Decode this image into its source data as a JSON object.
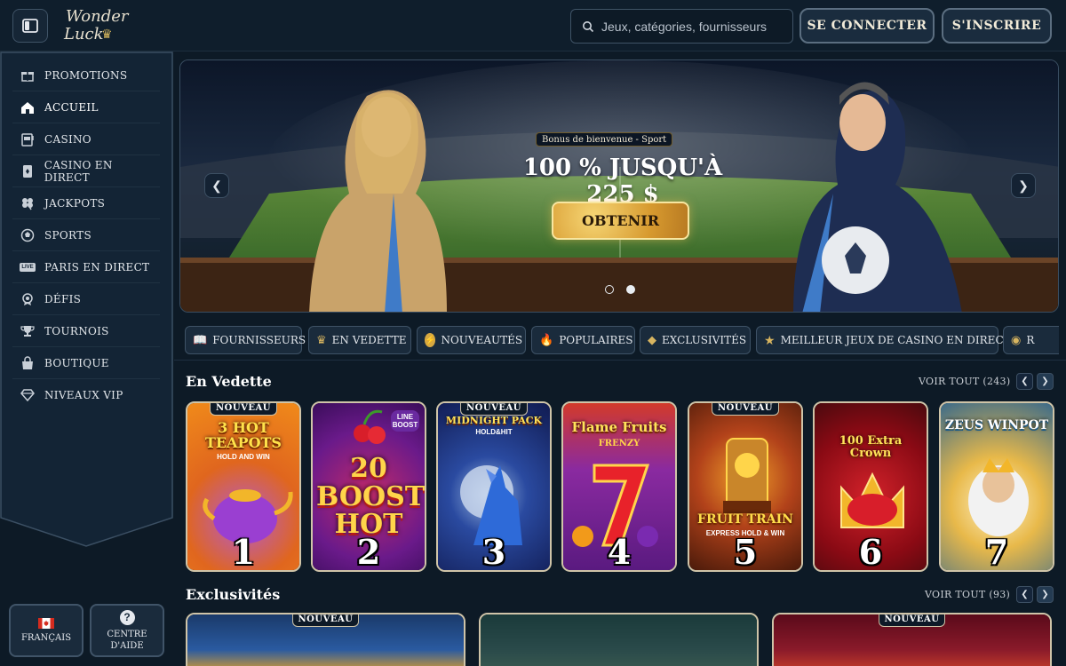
{
  "header": {
    "logo_line1": "Wonder",
    "logo_line2": "Luck",
    "search_placeholder": "Jeux, catégories, fournisseurs",
    "login_label": "SE CONNECTER",
    "register_label": "S'INSCRIRE"
  },
  "sidebar": {
    "items": [
      {
        "label": "PROMOTIONS",
        "icon": "gift-icon"
      },
      {
        "label": "ACCUEIL",
        "icon": "home-icon",
        "active": true
      },
      {
        "label": "CASINO",
        "icon": "slot-machine-icon"
      },
      {
        "label": "CASINO EN DIRECT",
        "icon": "cards-icon"
      },
      {
        "label": "JACKPOTS",
        "icon": "clover-icon"
      },
      {
        "label": "SPORTS",
        "icon": "soccer-ball-icon"
      },
      {
        "label": "PARIS EN DIRECT",
        "icon": "live-icon"
      },
      {
        "label": "DÉFIS",
        "icon": "medal-icon"
      },
      {
        "label": "TOURNOIS",
        "icon": "trophy-icon"
      },
      {
        "label": "BOUTIQUE",
        "icon": "shopping-bag-icon"
      },
      {
        "label": "NIVEAUX VIP",
        "icon": "diamond-icon"
      }
    ],
    "live_icon_text": "LIVE",
    "language_label": "FRANÇAIS",
    "help_label_line1": "CENTRE",
    "help_label_line2": "D'AIDE",
    "help_icon_text": "?"
  },
  "banner": {
    "tag": "Bonus de bienvenue - Sport",
    "headline": "100 % JUSQU'À 225 $",
    "cta": "OBTENIR",
    "slides": 2,
    "active_slide": 2
  },
  "categories": [
    {
      "label": "FOURNISSEURS",
      "icon": "book-icon"
    },
    {
      "label": "EN VEDETTE",
      "icon": "crown-icon"
    },
    {
      "label": "NOUVEAUTÉS",
      "icon": "lightning-icon"
    },
    {
      "label": "POPULAIRES",
      "icon": "flame-icon"
    },
    {
      "label": "EXCLUSIVITÉS",
      "icon": "diamond-icon"
    },
    {
      "label": "MEILLEUR JEUX DE CASINO EN DIRECT",
      "icon": "star-icon"
    },
    {
      "label": "R",
      "icon": "pot-icon"
    }
  ],
  "featured": {
    "title": "En Vedette",
    "see_all": "VOIR TOUT (243)",
    "games": [
      {
        "name": "3 HOT TEAPOTS",
        "sub": "HOLD AND WIN",
        "rank": "1",
        "badge": "NOUVEAU"
      },
      {
        "name": "20 BOOST HOT",
        "sub": "LINE BOOST",
        "rank": "2",
        "badge": ""
      },
      {
        "name": "MIDNIGHT PACK",
        "sub": "HOLD&HIT",
        "rank": "3",
        "badge": "NOUVEAU"
      },
      {
        "name": "Flame Fruits",
        "sub": "FRENZY",
        "rank": "4",
        "badge": ""
      },
      {
        "name": "FRUIT TRAIN",
        "sub": "EXPRESS HOLD & WIN",
        "rank": "5",
        "badge": "NOUVEAU"
      },
      {
        "name": "100 Extra Crown",
        "sub": "",
        "rank": "6",
        "badge": ""
      },
      {
        "name": "ZEUS WINPOT",
        "sub": "",
        "rank": "7",
        "badge": ""
      }
    ]
  },
  "exclusives": {
    "title": "Exclusivités",
    "see_all": "VOIR TOUT (93)",
    "badges": [
      "NOUVEAU",
      "",
      "NOUVEAU"
    ]
  }
}
